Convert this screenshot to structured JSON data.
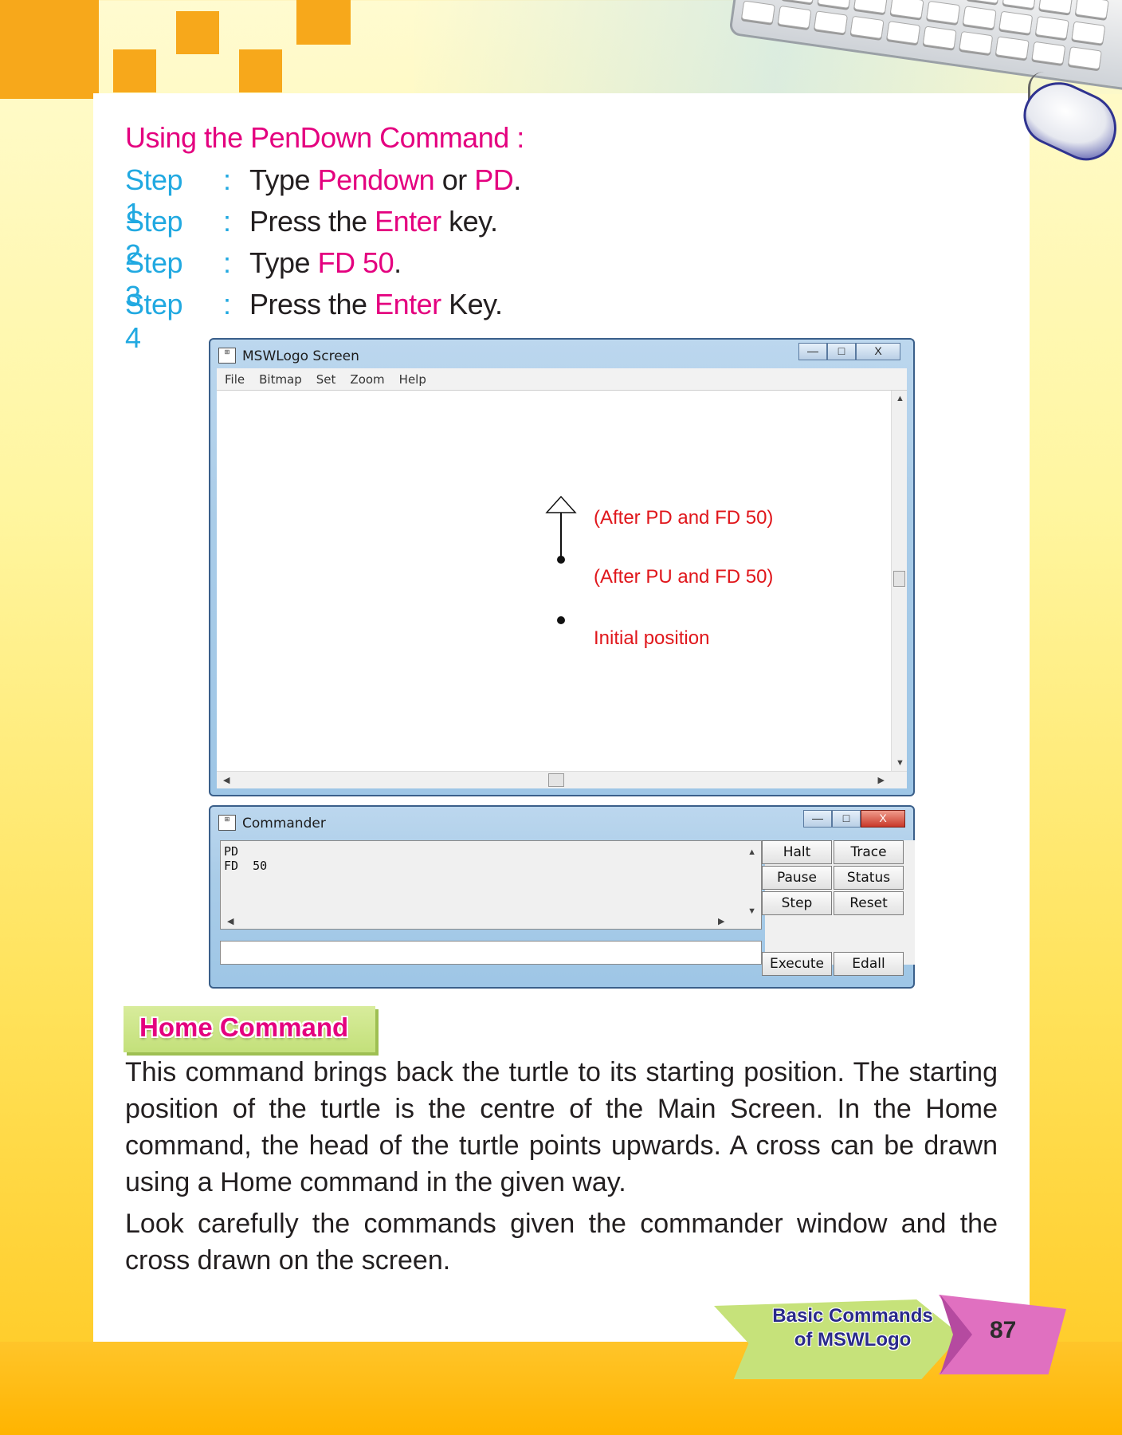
{
  "heading": "Using the PenDown Command :",
  "steps": [
    {
      "label": "Step 1",
      "colon": ":",
      "parts": [
        "Type ",
        "Pendown",
        " or ",
        "PD",
        "."
      ]
    },
    {
      "label": "Step 2",
      "colon": ":",
      "parts": [
        "Press the ",
        "Enter",
        " key.",
        "",
        ""
      ]
    },
    {
      "label": "Step 3",
      "colon": ":",
      "parts": [
        "Type ",
        "FD 50",
        ".",
        "",
        ""
      ]
    },
    {
      "label": "Step 4",
      "colon": ":",
      "parts": [
        "Press the ",
        "Enter",
        " Key.",
        "",
        ""
      ]
    }
  ],
  "screen_window": {
    "title": "MSWLogo Screen",
    "menu": [
      "File",
      "Bitmap",
      "Set",
      "Zoom",
      "Help"
    ],
    "annotations": [
      "(After PD and FD 50)",
      "(After PU and FD 50)",
      "Initial position"
    ],
    "controls": {
      "min": "—",
      "max": "□",
      "close": "X"
    }
  },
  "commander_window": {
    "title": "Commander",
    "history": [
      "PD",
      "FD  50"
    ],
    "buttons": [
      "Halt",
      "Trace",
      "Pause",
      "Status",
      "Step",
      "Reset"
    ],
    "bottom_buttons": [
      "Execute",
      "Edall"
    ],
    "controls": {
      "min": "—",
      "max": "□",
      "close": "X"
    }
  },
  "section_title": "Home Command",
  "paragraphs": [
    "This command brings back the turtle to its starting position. The starting position of the turtle is the centre of the Main Screen. In the Home command, the head of the turtle points upwards. A cross can be drawn using a Home command in the given way.",
    "Look carefully the commands given the commander window and the cross drawn on the screen."
  ],
  "footer": {
    "chapter_line1": "Basic Commands",
    "chapter_line2": "of MSWLogo",
    "page_number": "87"
  },
  "colors": {
    "accent_pink": "#e4007f",
    "step_blue": "#21a9e1",
    "annotation_red": "#e0161b",
    "orange": "#f7a81b"
  }
}
